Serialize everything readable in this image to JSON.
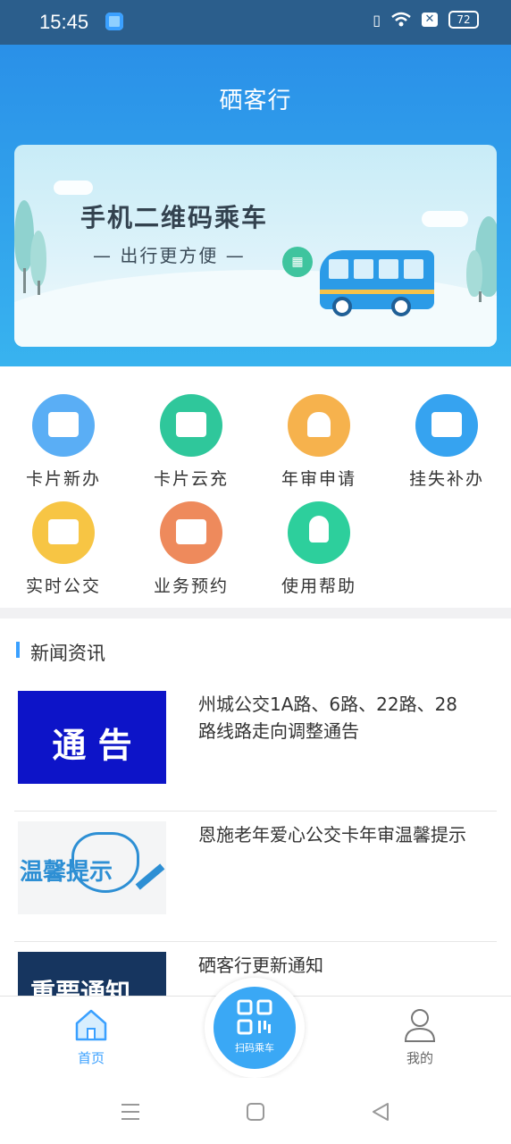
{
  "status_bar": {
    "time": "15:45",
    "battery": "72"
  },
  "header": {
    "title": "硒客行"
  },
  "banner": {
    "headline": "手机二维码乘车",
    "subline": "— 出行更方便 —"
  },
  "services": [
    {
      "label": "卡片新办",
      "icon": "card-icon",
      "color": "#5aaef5"
    },
    {
      "label": "卡片云充",
      "icon": "card-recharge-icon",
      "color": "#2fc79b"
    },
    {
      "label": "年审申请",
      "icon": "stamp-icon",
      "color": "#f6b24d"
    },
    {
      "label": "挂失补办",
      "icon": "card-loss-icon",
      "color": "#36a3f0"
    },
    {
      "label": "实时公交",
      "icon": "map-icon",
      "color": "#f7c544"
    },
    {
      "label": "业务预约",
      "icon": "calendar-icon",
      "color": "#ee8a5c"
    },
    {
      "label": "使用帮助",
      "icon": "lightbulb-icon",
      "color": "#2dcf9c"
    }
  ],
  "news": {
    "heading": "新闻资讯",
    "items": [
      {
        "title": "州城公交1A路、6路、22路、28路线路走向调整通告",
        "thumb_text": "通 告"
      },
      {
        "title": "恩施老年爱心公交卡年审温馨提示",
        "thumb_text": "温馨提示"
      },
      {
        "title": "硒客行更新通知",
        "thumb_text": "重要通知"
      }
    ]
  },
  "tabbar": {
    "home": "首页",
    "scan": "扫码乘车",
    "mine": "我的"
  },
  "colors": {
    "primary": "#3aa0ff",
    "header_top": "#2a90e8",
    "statusbar": "#2b5e8c"
  }
}
